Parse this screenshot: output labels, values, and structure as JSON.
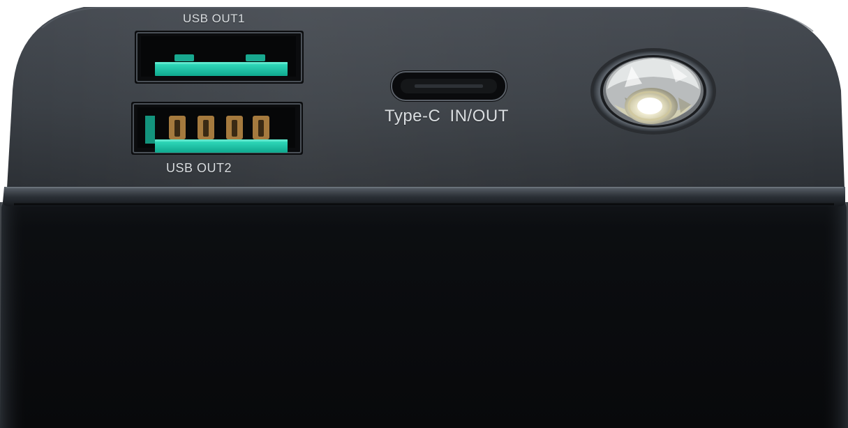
{
  "product": {
    "body_color": "#0b0d0f",
    "top_panel_color": "#3b4046",
    "port_accent_color": "#1ec4a6"
  },
  "ports": {
    "usb_out_1": {
      "label": "USB OUT1",
      "icon": "usb-a-port-icon"
    },
    "usb_out_2": {
      "label": "USB OUT2",
      "icon": "usb-a-port-icon"
    },
    "type_c": {
      "label": "Type-C IN/OUT",
      "icon": "usb-c-port-icon"
    },
    "flashlight": {
      "icon": "led-flashlight-icon",
      "lens_color": "#f4eecf"
    }
  }
}
